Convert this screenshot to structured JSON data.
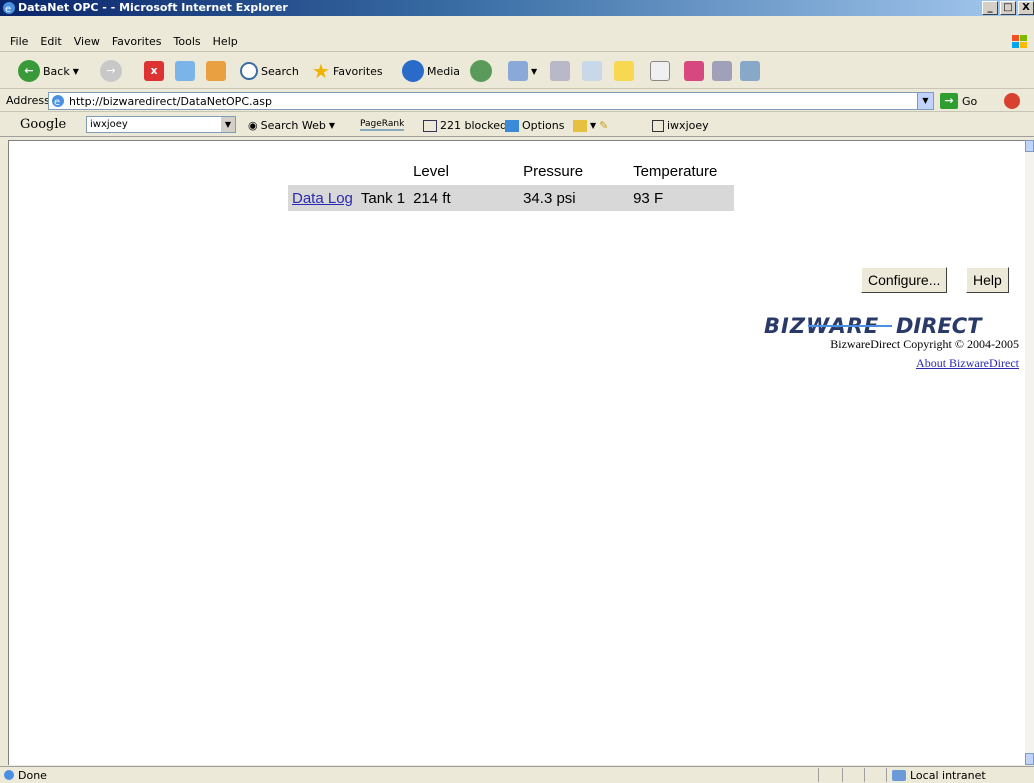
{
  "window": {
    "title": "DataNet OPC - - Microsoft Internet Explorer",
    "buttons": [
      "_",
      "□",
      "X"
    ]
  },
  "menu": [
    "File",
    "Edit",
    "View",
    "Favorites",
    "Tools",
    "Help"
  ],
  "toolbar": {
    "back": "Back",
    "search": "Search",
    "favorites": "Favorites",
    "media": "Media"
  },
  "address": {
    "label": "Address",
    "url": "http://bizwaredirect/DataNetOPC.asp",
    "go": "Go"
  },
  "google": {
    "logo": "Google",
    "query": "iwxjoey",
    "search_web": "Search Web",
    "pagerank": "PageRank",
    "blocked": "221 blocked",
    "options": "Options",
    "user": "iwxjoey"
  },
  "table": {
    "headers": [
      "Level",
      "Pressure",
      "Temperature"
    ],
    "rows": [
      {
        "link": "Data Log",
        "name": "Tank 1",
        "level": "214 ft",
        "pressure": "34.3 psi",
        "temperature": "93 F"
      }
    ]
  },
  "buttons": {
    "configure": "Configure...",
    "help": "Help"
  },
  "footer": {
    "logo_text": "BIZWAREDIRECT",
    "copyright": "BizwareDirect Copyright © 2004-2005",
    "about": "About BizwareDirect"
  },
  "status": {
    "text": "Done",
    "zone": "Local intranet"
  }
}
